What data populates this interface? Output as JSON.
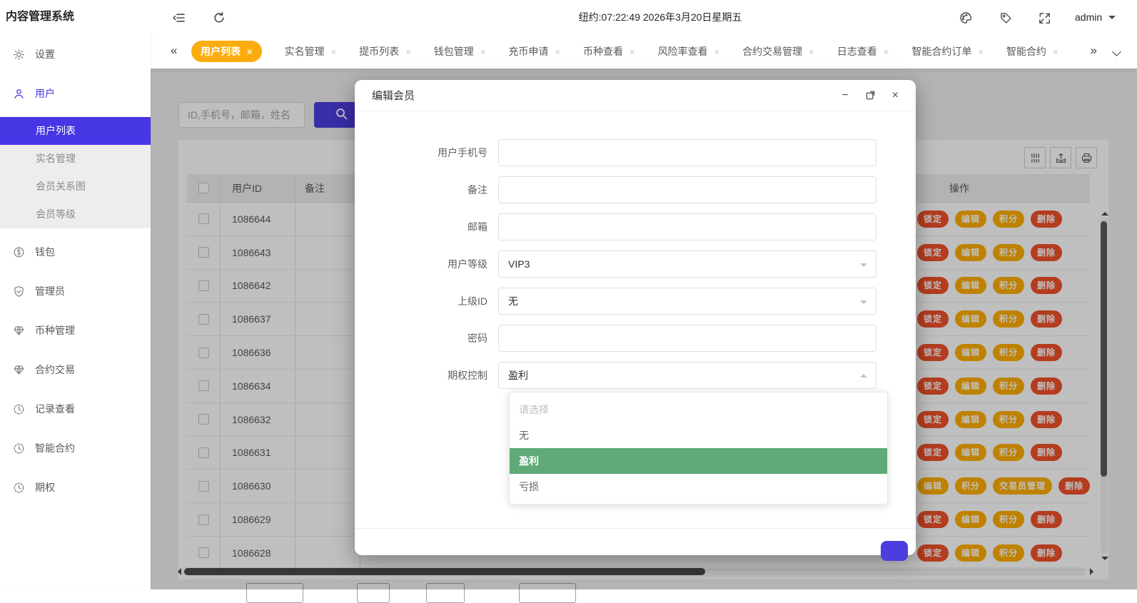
{
  "colors": {
    "accent": "#4636E3",
    "active_tab": "#FBAD0F",
    "action_yellow": "#FFAE00",
    "action_red": "#F0502A",
    "option_selected_green": "#5FAA78"
  },
  "glyphs": {
    "close": "×",
    "scroll_left": "«",
    "scroll_right": "»",
    "minimize": "−",
    "window_close": "×"
  },
  "header": {
    "app_title": "内容管理系统",
    "clock": "纽约:07:22:49 2026年3月20日星期五",
    "username": "admin"
  },
  "tabbar": {
    "tabs": [
      {
        "label": "用户列表",
        "active": true
      },
      {
        "label": "实名管理"
      },
      {
        "label": "提币列表"
      },
      {
        "label": "钱包管理"
      },
      {
        "label": "充币申请"
      },
      {
        "label": "币种查看"
      },
      {
        "label": "风险率查看"
      },
      {
        "label": "合约交易管理"
      },
      {
        "label": "日志查看"
      },
      {
        "label": "智能合约订单"
      },
      {
        "label": "智能合约"
      }
    ]
  },
  "sidebar": {
    "items": [
      {
        "label": "设置",
        "icon": "gear"
      },
      {
        "label": "用户",
        "icon": "user",
        "active": true,
        "submenu": [
          {
            "label": "用户列表",
            "active": true
          },
          {
            "label": "实名管理"
          },
          {
            "label": "会员关系图"
          },
          {
            "label": "会员等级"
          }
        ]
      },
      {
        "label": "钱包",
        "icon": "wallet"
      },
      {
        "label": "管理员",
        "icon": "shield"
      },
      {
        "label": "币种管理",
        "icon": "gem"
      },
      {
        "label": "合约交易",
        "icon": "gem"
      },
      {
        "label": "记录查看",
        "icon": "clock"
      },
      {
        "label": "智能合约",
        "icon": "clock"
      },
      {
        "label": "期权",
        "icon": "clock"
      }
    ]
  },
  "search": {
    "placeholder": "ID,手机号，邮箱，姓名"
  },
  "table": {
    "columns": [
      "用户ID",
      "备注",
      "操作"
    ],
    "rows": [
      {
        "id": "1086644",
        "remark": "",
        "actions": [
          {
            "label": "锁定",
            "color": "red"
          },
          {
            "label": "编辑",
            "color": "yellow"
          },
          {
            "label": "积分",
            "color": "yellow"
          },
          {
            "label": "删除",
            "color": "red"
          }
        ]
      },
      {
        "id": "1086643",
        "remark": "",
        "actions": [
          {
            "label": "锁定",
            "color": "red"
          },
          {
            "label": "编辑",
            "color": "yellow"
          },
          {
            "label": "积分",
            "color": "yellow"
          },
          {
            "label": "删除",
            "color": "red"
          }
        ]
      },
      {
        "id": "1086642",
        "remark": "",
        "actions": [
          {
            "label": "锁定",
            "color": "red"
          },
          {
            "label": "编辑",
            "color": "yellow"
          },
          {
            "label": "积分",
            "color": "yellow"
          },
          {
            "label": "删除",
            "color": "red"
          }
        ]
      },
      {
        "id": "1086637",
        "remark": "",
        "actions": [
          {
            "label": "锁定",
            "color": "red"
          },
          {
            "label": "编辑",
            "color": "yellow"
          },
          {
            "label": "积分",
            "color": "yellow"
          },
          {
            "label": "删除",
            "color": "red"
          }
        ]
      },
      {
        "id": "1086636",
        "remark": "",
        "actions": [
          {
            "label": "锁定",
            "color": "red"
          },
          {
            "label": "编辑",
            "color": "yellow"
          },
          {
            "label": "积分",
            "color": "yellow"
          },
          {
            "label": "删除",
            "color": "red"
          }
        ]
      },
      {
        "id": "1086634",
        "remark": "",
        "actions": [
          {
            "label": "锁定",
            "color": "red"
          },
          {
            "label": "编辑",
            "color": "yellow"
          },
          {
            "label": "积分",
            "color": "yellow"
          },
          {
            "label": "删除",
            "color": "red"
          }
        ]
      },
      {
        "id": "1086632",
        "remark": "",
        "actions": [
          {
            "label": "锁定",
            "color": "red"
          },
          {
            "label": "编辑",
            "color": "yellow"
          },
          {
            "label": "积分",
            "color": "yellow"
          },
          {
            "label": "删除",
            "color": "red"
          }
        ]
      },
      {
        "id": "1086631",
        "remark": "",
        "actions": [
          {
            "label": "锁定",
            "color": "red"
          },
          {
            "label": "编辑",
            "color": "yellow"
          },
          {
            "label": "积分",
            "color": "yellow"
          },
          {
            "label": "删除",
            "color": "red"
          }
        ]
      },
      {
        "id": "1086630",
        "remark": "",
        "actions": [
          {
            "label": "编辑",
            "color": "yellow"
          },
          {
            "label": "积分",
            "color": "yellow"
          },
          {
            "label": "交易员管理",
            "color": "yellow"
          },
          {
            "label": "删除",
            "color": "red"
          }
        ]
      },
      {
        "id": "1086629",
        "remark": "",
        "actions": [
          {
            "label": "锁定",
            "color": "red"
          },
          {
            "label": "编辑",
            "color": "yellow"
          },
          {
            "label": "积分",
            "color": "yellow"
          },
          {
            "label": "删除",
            "color": "red"
          }
        ]
      },
      {
        "id": "1086628",
        "remark": "",
        "actions": [
          {
            "label": "锁定",
            "color": "red"
          },
          {
            "label": "编辑",
            "color": "yellow"
          },
          {
            "label": "积分",
            "color": "yellow"
          },
          {
            "label": "删除",
            "color": "red"
          }
        ]
      }
    ]
  },
  "modal": {
    "title": "编辑会员",
    "fields": [
      {
        "label": "用户手机号",
        "type": "input",
        "value": ""
      },
      {
        "label": "备注",
        "type": "input",
        "value": ""
      },
      {
        "label": "邮箱",
        "type": "input",
        "value": ""
      },
      {
        "label": "用户等级",
        "type": "select",
        "value": "VIP3"
      },
      {
        "label": "上级ID",
        "type": "select",
        "value": "无"
      },
      {
        "label": "密码",
        "type": "input",
        "value": ""
      },
      {
        "label": "期权控制",
        "type": "select",
        "value": "盈利",
        "open": true
      }
    ],
    "dropdown": {
      "options": [
        {
          "label": "请选择",
          "state": "placeholder"
        },
        {
          "label": "无"
        },
        {
          "label": "盈利",
          "state": "selected"
        },
        {
          "label": "亏损"
        }
      ]
    }
  }
}
